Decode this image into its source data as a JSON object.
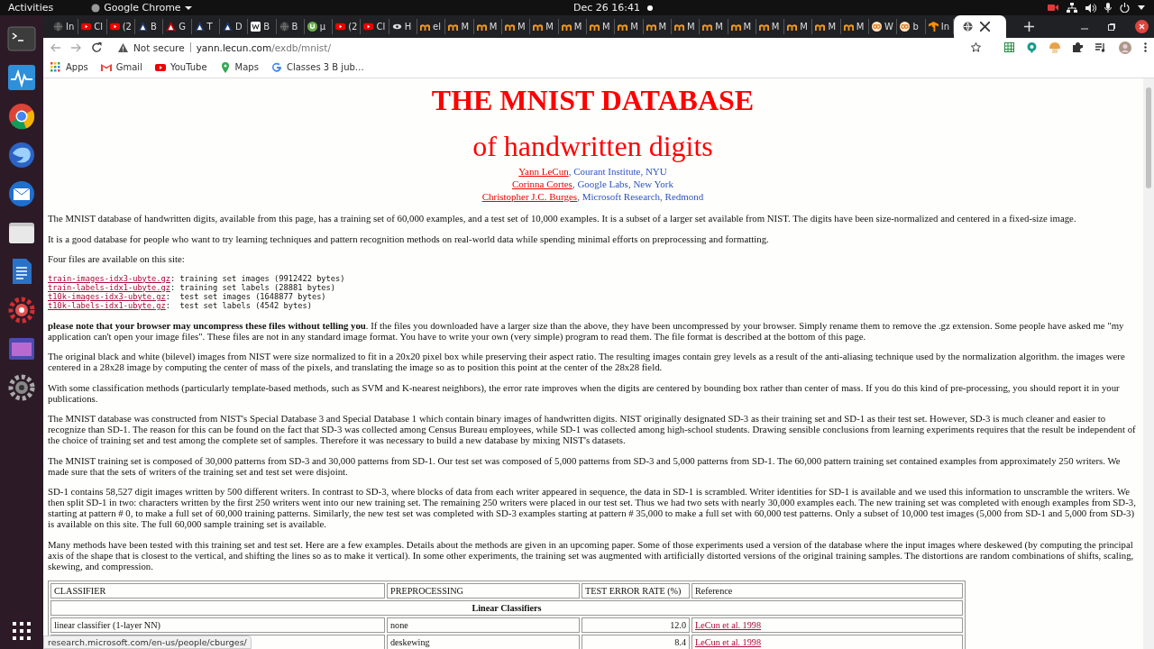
{
  "topbar": {
    "activities": "Activities",
    "app": "Google Chrome",
    "clock": "Dec 26  16:41"
  },
  "tabs": [
    {
      "label": "In",
      "kind": "globe",
      "selected": false
    },
    {
      "label": "Cl",
      "kind": "youtube",
      "selected": false
    },
    {
      "label": "(2",
      "kind": "youtube",
      "selected": false
    },
    {
      "label": "B",
      "kind": "arch",
      "selected": false
    },
    {
      "label": "G",
      "kind": "arch-red",
      "selected": false
    },
    {
      "label": "T",
      "kind": "arch",
      "selected": false
    },
    {
      "label": "D",
      "kind": "arch",
      "selected": false
    },
    {
      "label": "B",
      "kind": "wiki",
      "selected": false
    },
    {
      "label": "B",
      "kind": "globe",
      "selected": false
    },
    {
      "label": "µ",
      "kind": "torrent",
      "selected": false
    },
    {
      "label": "(2",
      "kind": "youtube",
      "selected": false
    },
    {
      "label": "Cl",
      "kind": "youtube",
      "selected": false
    },
    {
      "label": "H",
      "kind": "eye",
      "selected": false
    },
    {
      "label": "el",
      "kind": "moodle",
      "selected": false
    },
    {
      "label": "M",
      "kind": "moodle",
      "selected": false
    },
    {
      "label": "M",
      "kind": "moodle",
      "selected": false
    },
    {
      "label": "M",
      "kind": "moodle",
      "selected": false
    },
    {
      "label": "M",
      "kind": "moodle",
      "selected": false
    },
    {
      "label": "M",
      "kind": "moodle",
      "selected": false
    },
    {
      "label": "M",
      "kind": "moodle",
      "selected": false
    },
    {
      "label": "M",
      "kind": "moodle",
      "selected": false
    },
    {
      "label": "M",
      "kind": "moodle",
      "selected": false
    },
    {
      "label": "M",
      "kind": "moodle",
      "selected": false
    },
    {
      "label": "M",
      "kind": "moodle",
      "selected": false
    },
    {
      "label": "M",
      "kind": "moodle",
      "selected": false
    },
    {
      "label": "M",
      "kind": "moodle",
      "selected": false
    },
    {
      "label": "M",
      "kind": "moodle",
      "selected": false
    },
    {
      "label": "M",
      "kind": "moodle",
      "selected": false
    },
    {
      "label": "M",
      "kind": "moodle",
      "selected": false
    },
    {
      "label": "W",
      "kind": "cc",
      "selected": false
    },
    {
      "label": "b",
      "kind": "cc",
      "selected": false
    },
    {
      "label": "In",
      "kind": "tf",
      "selected": false
    },
    {
      "kind": "globe",
      "selected": true
    }
  ],
  "address": {
    "security": "Not secure",
    "host": "yann.lecun.com",
    "path": "/exdb/mnist/"
  },
  "bookmarks": [
    {
      "label": "Apps",
      "kind": "apps"
    },
    {
      "label": "Gmail",
      "kind": "gmail"
    },
    {
      "label": "YouTube",
      "kind": "youtube"
    },
    {
      "label": "Maps",
      "kind": "maps"
    },
    {
      "label": "Classes 3 B jub…",
      "kind": "google"
    }
  ],
  "page": {
    "title": "THE MNIST DATABASE",
    "subtitle": "of handwritten digits",
    "authors": [
      {
        "name": "Yann LeCun",
        "affiliation": ", Courant Institute, NYU"
      },
      {
        "name": "Corinna Cortes",
        "affiliation": ", Google Labs, New York"
      },
      {
        "name": "Christopher J.C. Burges",
        "affiliation": ", Microsoft Research, Redmond"
      }
    ],
    "intro": [
      "The MNIST database of handwritten digits, available from this page, has a training set of 60,000 examples, and a test set of 10,000 examples. It is a subset of a larger set available from NIST. The digits have been size-normalized and centered in a fixed-size image.",
      "It is a good database for people who want to try learning techniques and pattern recognition methods on real-world data while spending minimal efforts on preprocessing and formatting.",
      "Four files are available on this site:"
    ],
    "files": [
      {
        "name": "train-images-idx3-ubyte.gz",
        "sep": ":",
        "description": "training set images (9912422 bytes)"
      },
      {
        "name": "train-labels-idx1-ubyte.gz",
        "sep": ":",
        "description": "training set labels (28881 bytes)"
      },
      {
        "name": "t10k-images-idx3-ubyte.gz",
        "sep": ": ",
        "description": "test set images (1648877 bytes)"
      },
      {
        "name": "t10k-labels-idx1-ubyte.gz",
        "sep": ": ",
        "description": "test set labels (4542 bytes)"
      }
    ],
    "paragraphs": [
      "**please note that your browser may uncompress these files without telling you**. If the files you downloaded have a larger size than the above, they have been uncompressed by your browser. Simply rename them to remove the .gz extension. Some people have asked me \"my application can't open your image files\". These files are not in any standard image format. You have to write your own (very simple) program to read them. The file format is described at the bottom of this page.",
      "The original black and white (bilevel) images from NIST were size normalized to fit in a 20x20 pixel box while preserving their aspect ratio. The resulting images contain grey levels as a result of the anti-aliasing technique used by the normalization algorithm. the images were centered in a 28x28 image by computing the center of mass of the pixels, and translating the image so as to position this point at the center of the 28x28 field.",
      "With some classification methods (particularly template-based methods, such as SVM and K-nearest neighbors), the error rate improves when the digits are centered by bounding box rather than center of mass. If you do this kind of pre-processing, you should report it in your publications.",
      "The MNIST database was constructed from NIST's Special Database 3 and Special Database 1 which contain binary images of handwritten digits. NIST originally designated SD-3 as their training set and SD-1 as their test set. However, SD-3 is much cleaner and easier to recognize than SD-1. The reason for this can be found on the fact that SD-3 was collected among Census Bureau employees, while SD-1 was collected among high-school students. Drawing sensible conclusions from learning experiments requires that the result be independent of the choice of training set and test among the complete set of samples. Therefore it was necessary to build a new database by mixing NIST's datasets.",
      "The MNIST training set is composed of 30,000 patterns from SD-3 and 30,000 patterns from SD-1. Our test set was composed of 5,000 patterns from SD-3 and 5,000 patterns from SD-1. The 60,000 pattern training set contained examples from approximately 250 writers. We made sure that the sets of writers of the training set and test set were disjoint.",
      "SD-1 contains 58,527 digit images written by 500 different writers. In contrast to SD-3, where blocks of data from each writer appeared in sequence, the data in SD-1 is scrambled. Writer identities for SD-1 is available and we used this information to unscramble the writers. We then split SD-1 in two: characters written by the first 250 writers went into our new training set. The remaining 250 writers were placed in our test set. Thus we had two sets with nearly 30,000 examples each. The new training set was completed with enough examples from SD-3, starting at pattern # 0, to make a full set of 60,000 training patterns. Similarly, the new test set was completed with SD-3 examples starting at pattern # 35,000 to make a full set with 60,000 test patterns. Only a subset of 10,000 test images (5,000 from SD-1 and 5,000 from SD-3) is available on this site. The full 60,000 sample training set is available.",
      "Many methods have been tested with this training set and test set. Here are a few examples. Details about the methods are given in an upcoming paper. Some of those experiments used a version of the database where the input images where deskewed (by computing the principal axis of the shape that is closest to the vertical, and shifting the lines so as to make it vertical). In some other experiments, the training set was augmented with artificially distorted versions of the original training samples. The distortions are random combinations of shifts, scaling, skewing, and compression."
    ],
    "table": {
      "columns": [
        "CLASSIFIER",
        "PREPROCESSING",
        "TEST ERROR RATE (%)",
        "Reference"
      ],
      "section": "Linear Classifiers",
      "rows": [
        {
          "classifier": "linear classifier (1-layer NN)",
          "preprocessing": "none",
          "error": "12.0",
          "reference": "LeCun et al. 1998"
        },
        {
          "preprocessing": "deskewing",
          "error": "8.4",
          "reference": "LeCun et al. 1998"
        }
      ]
    }
  },
  "status_bubble": "research.microsoft.com/en-us/people/cburges/"
}
